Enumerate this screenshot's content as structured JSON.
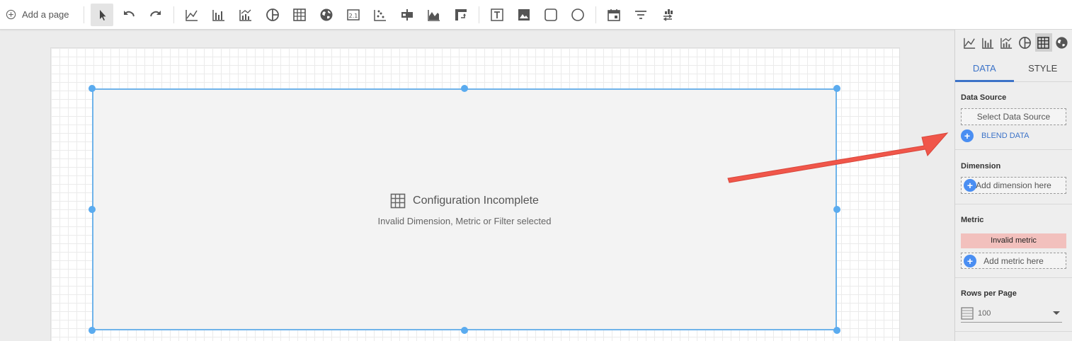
{
  "toolbar": {
    "add_page_label": "Add a page",
    "icons": [
      "select-icon",
      "undo-icon",
      "redo-icon",
      "time-series-icon",
      "bar-chart-icon",
      "combo-chart-icon",
      "pie-chart-icon",
      "table-icon",
      "geo-map-icon",
      "scorecard-icon",
      "scatter-chart-icon",
      "bullet-chart-icon",
      "area-chart-icon",
      "pivot-table-icon",
      "text-icon",
      "image-icon",
      "rectangle-icon",
      "circle-icon",
      "date-range-icon",
      "filter-icon",
      "data-control-icon"
    ]
  },
  "chart": {
    "title": "Configuration Incomplete",
    "subtitle": "Invalid Dimension, Metric or Filter selected"
  },
  "panel": {
    "tabs": {
      "data": "DATA",
      "style": "STYLE"
    },
    "data_source": {
      "title": "Data Source",
      "placeholder": "Select Data Source",
      "blend_label": "BLEND DATA"
    },
    "dimension": {
      "title": "Dimension",
      "add_label": "Add dimension here"
    },
    "metric": {
      "title": "Metric",
      "invalid_label": "Invalid metric",
      "add_label": "Add metric here"
    },
    "rows_per_page": {
      "title": "Rows per Page",
      "value": "100"
    }
  },
  "colors": {
    "selection": "#5aabef",
    "accent": "#3c73c8",
    "arrow": "#f0564a",
    "invalid_bg": "#f2c0bd"
  }
}
